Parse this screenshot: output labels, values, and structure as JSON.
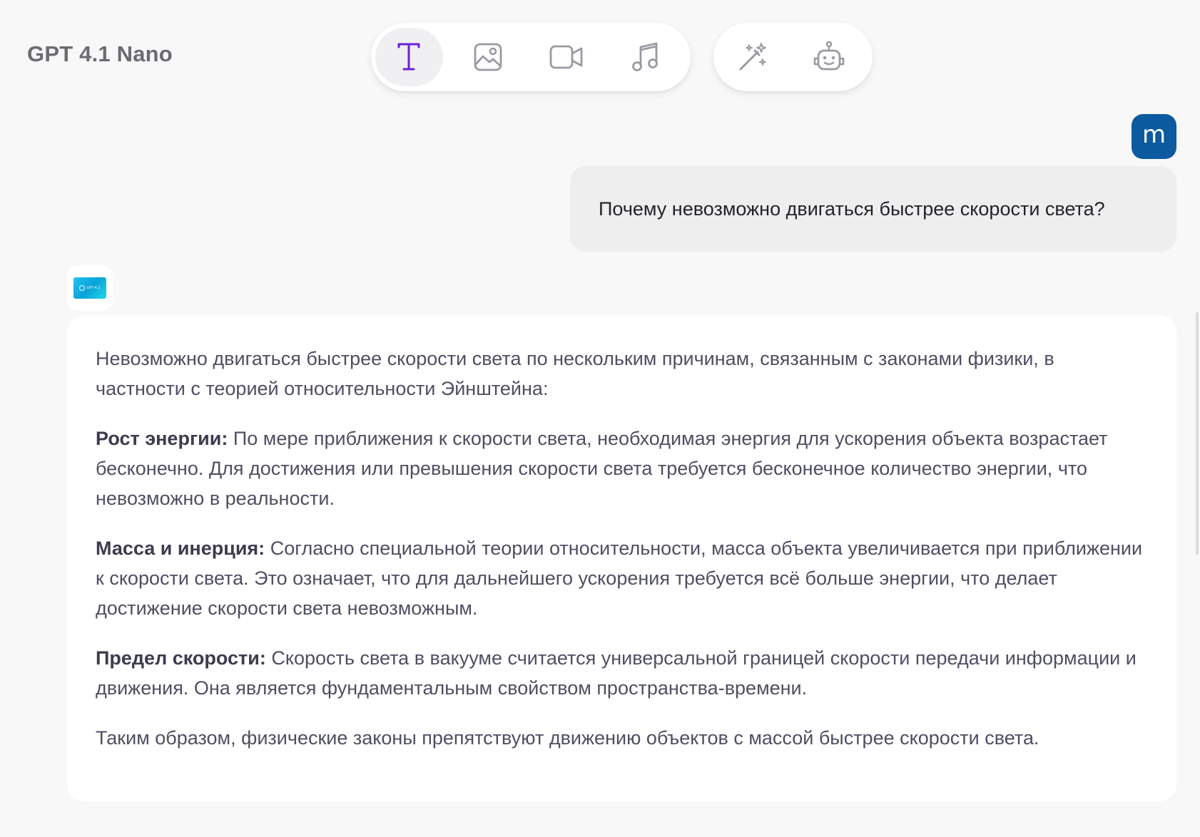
{
  "header": {
    "model_name": "GPT 4.1 Nano"
  },
  "toolbar": {
    "modes": [
      {
        "icon": "text-icon",
        "active": true
      },
      {
        "icon": "image-icon",
        "active": false
      },
      {
        "icon": "video-icon",
        "active": false
      },
      {
        "icon": "music-icon",
        "active": false
      }
    ],
    "tools": [
      {
        "icon": "magic-wand-icon"
      },
      {
        "icon": "robot-icon"
      }
    ],
    "accent_color": "#6a22d8",
    "icon_color": "#9a9aa2"
  },
  "user_message": {
    "avatar_letter": "m",
    "avatar_color": "#0c5aa0",
    "text": "Почему невозможно двигаться быстрее скорости света?"
  },
  "bot_message": {
    "avatar_label": "GPT-4.1",
    "intro": "Невозможно двигаться быстрее скорости света по нескольким причинам, связанным с законами физики, в частности с теорией относительности Эйнштейна:",
    "points": [
      {
        "title": "Рост энергии:",
        "text": " По мере приближения к скорости света, необходимая энергия для ускорения объекта возрастает бесконечно. Для достижения или превышения скорости света требуется бесконечное количество энергии, что невозможно в реальности."
      },
      {
        "title": "Масса и инерция:",
        "text": " Согласно специальной теории относительности, масса объекта увеличивается при приближении к скорости света. Это означает, что для дальнейшего ускорения требуется всё больше энергии, что делает достижение скорости света невозможным."
      },
      {
        "title": "Предел скорости:",
        "text": " Скорость света в вакууме считается универсальной границей скорости передачи информации и движения. Она является фундаментальным свойством пространства-времени."
      }
    ],
    "conclusion": "Таким образом, физические законы препятствуют движению объектов с массой быстрее скорости света."
  }
}
